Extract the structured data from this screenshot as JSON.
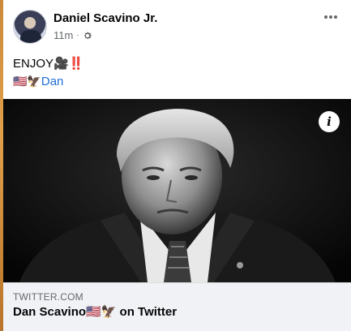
{
  "post": {
    "author": "Daniel Scavino Jr.",
    "timestamp": "11m",
    "separator": "·",
    "audience_icon": "gear-icon",
    "text_line1": "ENJOY🎥‼️",
    "text_line2_prefix": "🇺🇸🦅",
    "tag": "Dan"
  },
  "link_preview": {
    "domain": "TWITTER.COM",
    "title": "Dan Scavino🇺🇸🦅 on Twitter",
    "info_label": "i"
  },
  "colors": {
    "link": "#216fdb",
    "meta": "#65676b",
    "footer_bg": "#f0f2f5"
  }
}
